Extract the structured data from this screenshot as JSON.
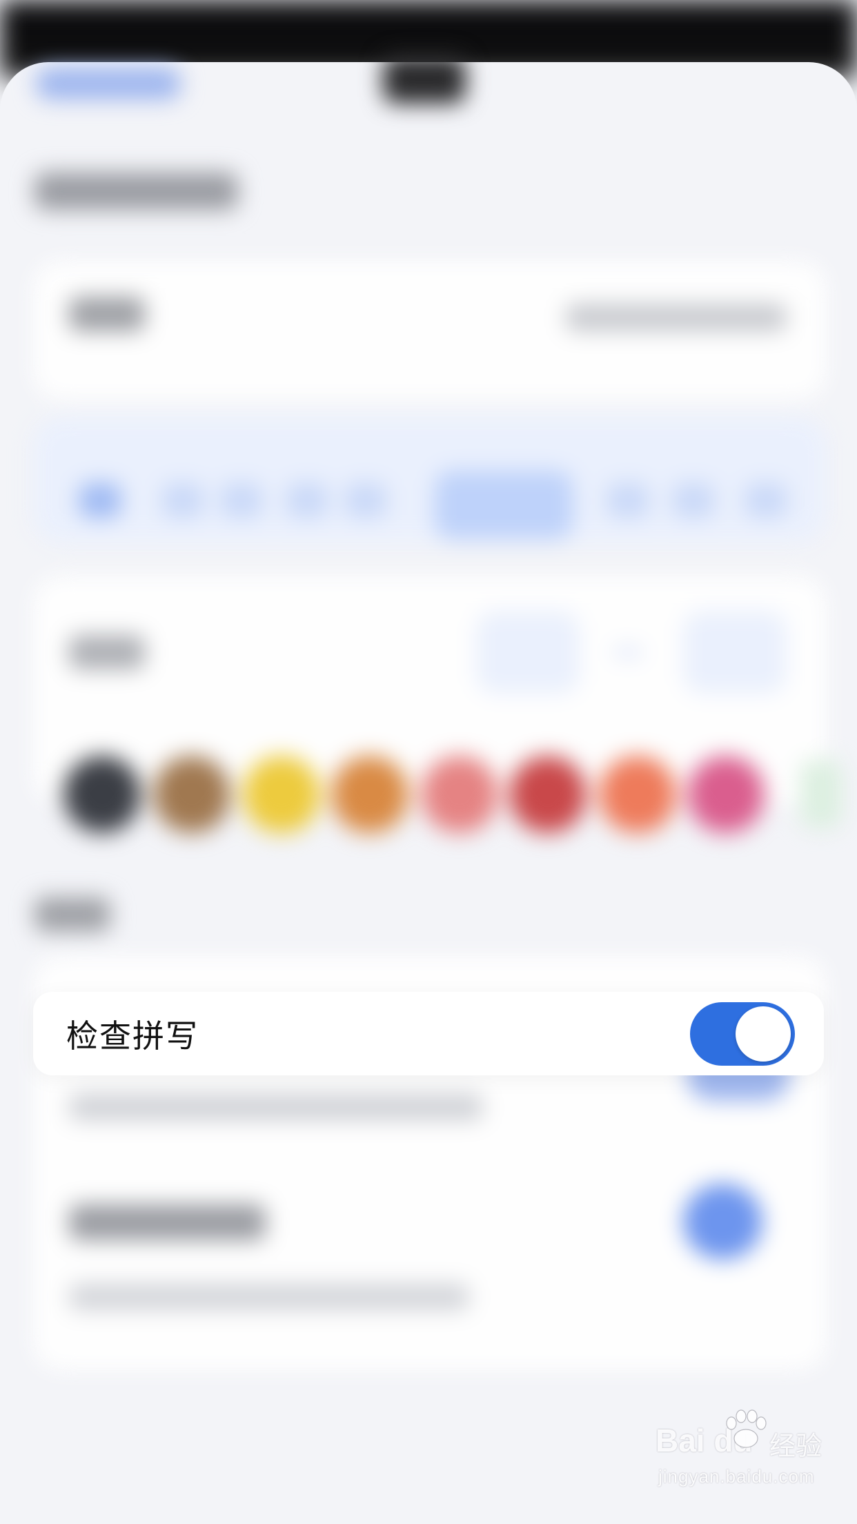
{
  "setting": {
    "label": "检查拼写",
    "enabled": true
  },
  "colors": {
    "toggle_on": "#2E6FE0",
    "swatches": [
      "#3B3E45",
      "#A07850",
      "#EDCB3E",
      "#D98A44",
      "#E58383",
      "#C9484A",
      "#EE7B5B",
      "#DA5E8E"
    ]
  },
  "watermark": {
    "brand": "Bai du",
    "brand_cn": "经验",
    "url": "jingyan.baidu.com"
  }
}
